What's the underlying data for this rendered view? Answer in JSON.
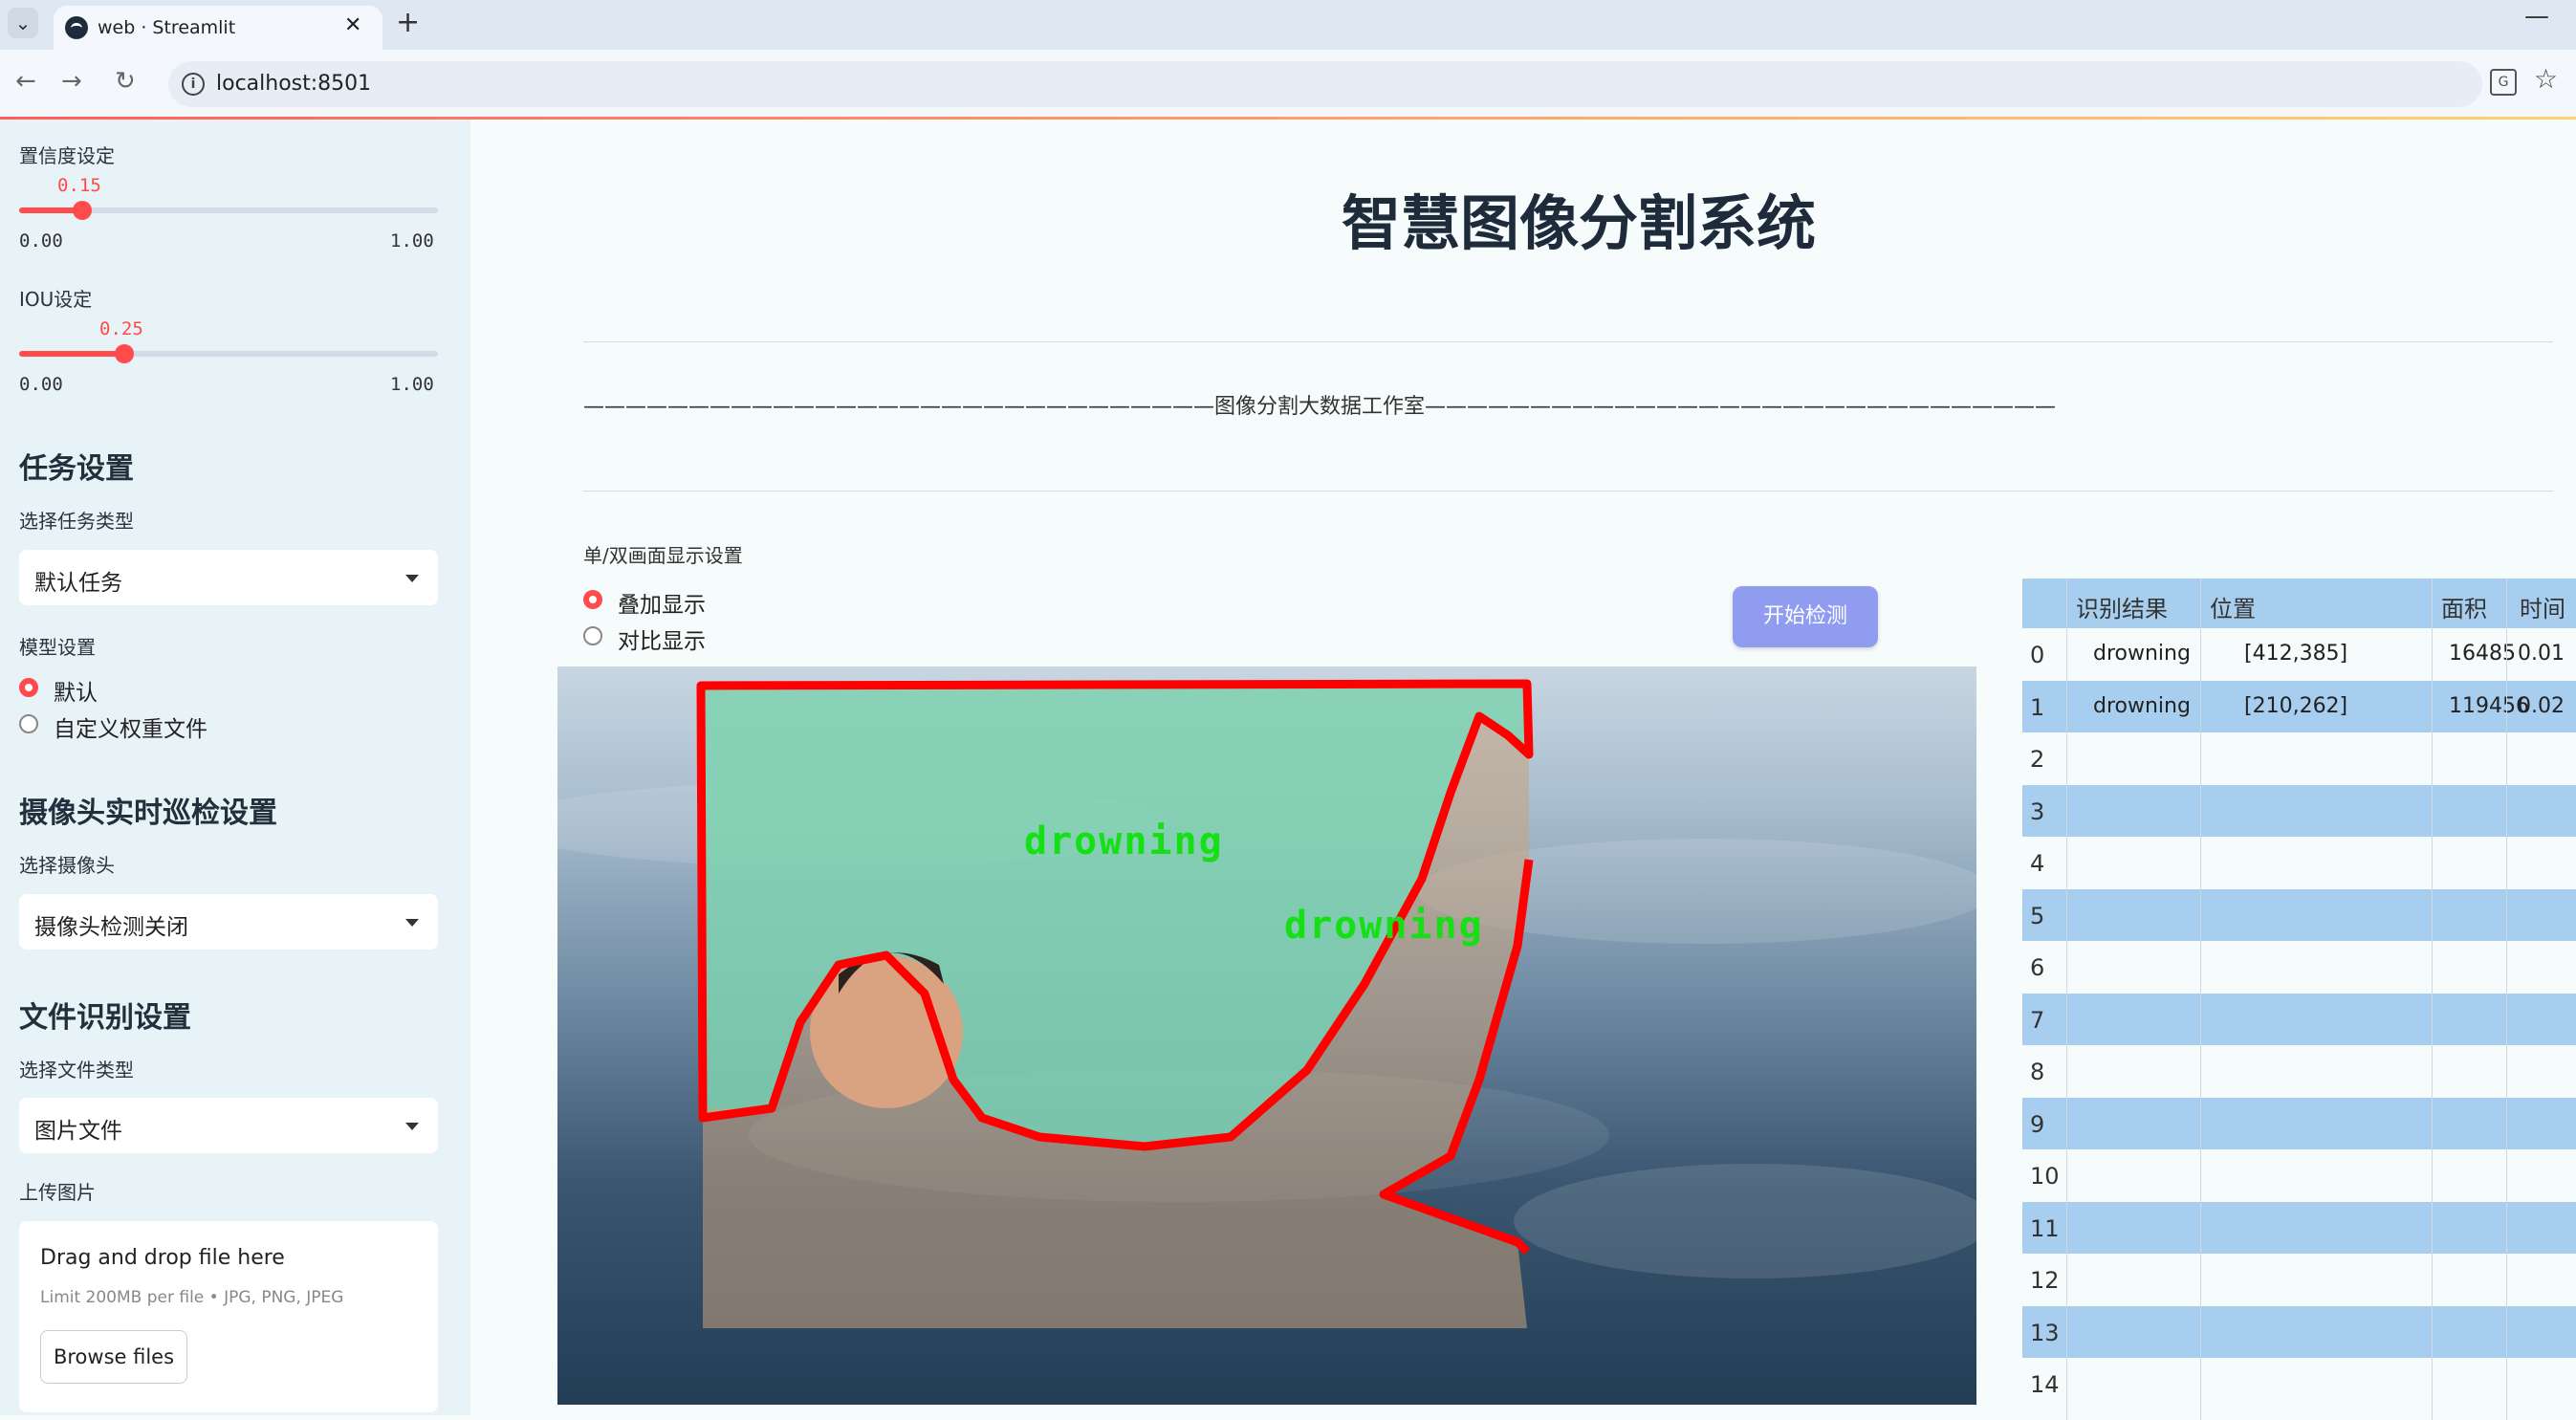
{
  "browser": {
    "tab_title": "web · Streamlit",
    "url": "localhost:8501"
  },
  "sidebar": {
    "confidence": {
      "label": "置信度设定",
      "value": "0.15",
      "min": "0.00",
      "max": "1.00",
      "fraction": 0.15
    },
    "iou": {
      "label": "IOU设定",
      "value": "0.25",
      "min": "0.00",
      "max": "1.00",
      "fraction": 0.25
    },
    "task_section": "任务设置",
    "task_type_label": "选择任务类型",
    "task_type_value": "默认任务",
    "model_label": "模型设置",
    "model_options": [
      "默认",
      "自定义权重文件"
    ],
    "camera_section": "摄像头实时巡检设置",
    "camera_label": "选择摄像头",
    "camera_value": "摄像头检测关闭",
    "file_section": "文件识别设置",
    "file_type_label": "选择文件类型",
    "file_type_value": "图片文件",
    "upload_label": "上传图片",
    "upload_main": "Drag and drop file here",
    "upload_sub": "Limit 200MB per file • JPG, PNG, JPEG",
    "browse_label": "Browse files"
  },
  "main": {
    "title": "智慧图像分割系统",
    "divider_text": "——————————————————————————————图像分割大数据工作室——————————————————————————————",
    "display_mode_label": "单/双画面显示设置",
    "display_options": [
      "叠加显示",
      "对比显示"
    ],
    "start_button": "开始检测",
    "detections": [
      "drowning",
      "drowning"
    ]
  },
  "table": {
    "headers": [
      "识别结果",
      "位置",
      "面积",
      "时间"
    ],
    "rows": [
      {
        "idx": "0",
        "result": "drowning",
        "pos": "[412,385]",
        "area": "16485",
        "time": "0.01"
      },
      {
        "idx": "1",
        "result": "drowning",
        "pos": "[210,262]",
        "area": "119456",
        "time": "0.02"
      },
      {
        "idx": "2"
      },
      {
        "idx": "3"
      },
      {
        "idx": "4"
      },
      {
        "idx": "5"
      },
      {
        "idx": "6"
      },
      {
        "idx": "7"
      },
      {
        "idx": "8"
      },
      {
        "idx": "9"
      },
      {
        "idx": "10"
      },
      {
        "idx": "11"
      },
      {
        "idx": "12"
      },
      {
        "idx": "13"
      },
      {
        "idx": "14"
      }
    ]
  },
  "colors": {
    "accent": "#ff4b4b",
    "button": "#8f9cf0",
    "table_band": "#a7cdef",
    "mask": "#7fd2b0",
    "outline": "#ff0000",
    "label": "#14e014"
  }
}
